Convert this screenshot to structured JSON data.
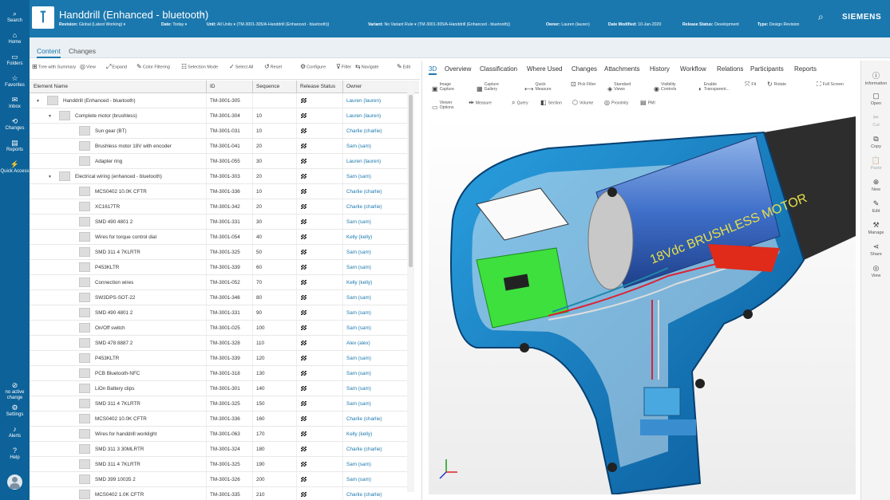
{
  "leftnav": [
    {
      "icon": "search-icon",
      "glyph": "⌕",
      "label": "Search"
    },
    {
      "icon": "home-icon",
      "glyph": "⌂",
      "label": "Home"
    },
    {
      "icon": "folder-icon",
      "glyph": "▭",
      "label": "Folders"
    },
    {
      "icon": "star-icon",
      "glyph": "☆",
      "label": "Favorites"
    },
    {
      "icon": "inbox-icon",
      "glyph": "✉",
      "label": "Inbox"
    },
    {
      "icon": "changes-icon",
      "glyph": "⟲",
      "label": "Changes"
    },
    {
      "icon": "reports-icon",
      "glyph": "▤",
      "label": "Reports"
    },
    {
      "icon": "quick-access-icon",
      "glyph": "⚡",
      "label": "Quick Access"
    }
  ],
  "leftnav_bottom": {
    "no_change": "no active change",
    "settings": "Settings",
    "alerts": "Alerts",
    "help": "Help"
  },
  "header": {
    "title": "Handdrill (Enhanced - bluetooth)",
    "revision_label": "Revision:",
    "revision": "Global (Latest Working)",
    "date_label": "Date:",
    "date": "Today",
    "unit_label": "Unit:",
    "unit": "All Units",
    "unit_id": "(TM-3001-305/A-Handdrill (Enhanced - bluetooth))",
    "variant_label": "Variant:",
    "variant": "No Variant Rule",
    "variant_id": "(TM-3001-305/A-Handdrill (Enhanced - bluetooth))",
    "owner_label": "Owner:",
    "owner": "Lauren (lauren)",
    "modified_label": "Date Modified:",
    "modified": "10-Jan-2020",
    "status_label": "Release Status:",
    "status": "Development",
    "type_label": "Type:",
    "type": "Design Revision",
    "brand": "SIEMENS"
  },
  "maintabs": [
    "Content",
    "Changes"
  ],
  "left_toolbar": [
    {
      "label": "Tree with Summary",
      "icon": "tree-icon",
      "g": "⊞"
    },
    {
      "label": "View",
      "icon": "view-icon",
      "g": "◎"
    },
    {
      "label": "Expand",
      "icon": "expand-icon",
      "g": "⤢"
    },
    {
      "label": "Color Filtering",
      "icon": "color-filter-icon",
      "g": "✎"
    },
    {
      "label": "Selection Mode",
      "icon": "selection-mode-icon",
      "g": "☷"
    },
    {
      "label": "Select All",
      "icon": "check-icon",
      "g": "✓"
    },
    {
      "label": "Reset",
      "icon": "reset-icon",
      "g": "↺"
    },
    {
      "label": "Configure",
      "icon": "configure-icon",
      "g": "⚙"
    },
    {
      "label": "Filter",
      "icon": "filter-icon",
      "g": "⊽"
    },
    {
      "label": "Navigate",
      "icon": "navigate-icon",
      "g": "⇆"
    },
    {
      "label": "Edit",
      "icon": "edit-icon",
      "g": "✎"
    }
  ],
  "table": {
    "headers": [
      "Element Name",
      "ID",
      "Sequence",
      "Release Status",
      "Owner"
    ],
    "rows": [
      {
        "level": 0,
        "tri": "▼",
        "name": "Handdrill (Enhanced - bluetooth)",
        "id": "TM-3001-305",
        "seq": "",
        "owner": "Lauren (lauren)"
      },
      {
        "level": 1,
        "tri": "▼",
        "name": "Complete motor (brushless)",
        "id": "TM-3001-304",
        "seq": "10",
        "owner": "Lauren (lauren)"
      },
      {
        "level": 2,
        "tri": "",
        "name": "Sun gear (BT)",
        "id": "TM-3001-031",
        "seq": "10",
        "owner": "Charlie (charlie)"
      },
      {
        "level": 2,
        "tri": "",
        "name": "Brushless motor 18V with encoder",
        "id": "TM-3001-041",
        "seq": "20",
        "owner": "Sam (sam)"
      },
      {
        "level": 2,
        "tri": "",
        "name": "Adapter ring",
        "id": "TM-3001-055",
        "seq": "30",
        "owner": "Lauren (lauren)"
      },
      {
        "level": 1,
        "tri": "▼",
        "name": "Electrical wiring (enhanced - bluetooth)",
        "id": "TM-3001-303",
        "seq": "20",
        "owner": "Sam (sam)"
      },
      {
        "level": 2,
        "tri": "",
        "name": "MCS0402 10.0K CFTR",
        "id": "TM-3001-336",
        "seq": "10",
        "owner": "Charlie (charlie)"
      },
      {
        "level": 2,
        "tri": "",
        "name": "XC1617TR",
        "id": "TM-3001-342",
        "seq": "20",
        "owner": "Charlie (charlie)"
      },
      {
        "level": 2,
        "tri": "",
        "name": "SMD 490 4801 2",
        "id": "TM-3001-331",
        "seq": "30",
        "owner": "Sam (sam)"
      },
      {
        "level": 2,
        "tri": "",
        "name": "Wires for torque control dial",
        "id": "TM-3001-054",
        "seq": "40",
        "owner": "Kelly (kelly)"
      },
      {
        "level": 2,
        "tri": "",
        "name": "SMD 311 4 7KLRTR",
        "id": "TM-3001-325",
        "seq": "50",
        "owner": "Sam (sam)"
      },
      {
        "level": 2,
        "tri": "",
        "name": "P453KLTR",
        "id": "TM-3001-339",
        "seq": "60",
        "owner": "Sam (sam)"
      },
      {
        "level": 2,
        "tri": "",
        "name": "Connection wires",
        "id": "TM-3001-052",
        "seq": "70",
        "owner": "Kelly (kelly)"
      },
      {
        "level": 2,
        "tri": "",
        "name": "SW3DPS-SOT-22",
        "id": "TM-3001-346",
        "seq": "80",
        "owner": "Sam (sam)"
      },
      {
        "level": 2,
        "tri": "",
        "name": "SMD 490 4801 2",
        "id": "TM-3001-331",
        "seq": "90",
        "owner": "Sam (sam)"
      },
      {
        "level": 2,
        "tri": "",
        "name": "On/Off switch",
        "id": "TM-3001-025",
        "seq": "100",
        "owner": "Sam (sam)"
      },
      {
        "level": 2,
        "tri": "",
        "name": "SMD 478 8887 2",
        "id": "TM-3001-328",
        "seq": "110",
        "owner": "Alex (alex)"
      },
      {
        "level": 2,
        "tri": "",
        "name": "P453KLTR",
        "id": "TM-3001-339",
        "seq": "120",
        "owner": "Sam (sam)"
      },
      {
        "level": 2,
        "tri": "",
        "name": "PCB Bluetooth-NFC",
        "id": "TM-3001-318",
        "seq": "130",
        "owner": "Sam (sam)"
      },
      {
        "level": 2,
        "tri": "",
        "name": "LiOn Battery clips",
        "id": "TM-3001-301",
        "seq": "140",
        "owner": "Sam (sam)"
      },
      {
        "level": 2,
        "tri": "",
        "name": "SMD 311 4 7KLRTR",
        "id": "TM-3001-325",
        "seq": "150",
        "owner": "Sam (sam)"
      },
      {
        "level": 2,
        "tri": "",
        "name": "MCS0402 10.0K CFTR",
        "id": "TM-3001-336",
        "seq": "160",
        "owner": "Charlie (charlie)"
      },
      {
        "level": 2,
        "tri": "",
        "name": "Wires for handdrill worklight",
        "id": "TM-3001-063",
        "seq": "170",
        "owner": "Kelly (kelly)"
      },
      {
        "level": 2,
        "tri": "",
        "name": "SMD 311 3 30MLRTR",
        "id": "TM-3001-324",
        "seq": "180",
        "owner": "Charlie (charlie)"
      },
      {
        "level": 2,
        "tri": "",
        "name": "SMD 311 4 7KLRTR",
        "id": "TM-3001-325",
        "seq": "190",
        "owner": "Sam (sam)"
      },
      {
        "level": 2,
        "tri": "",
        "name": "SMD 399 10035 2",
        "id": "TM-3001-326",
        "seq": "200",
        "owner": "Sam (sam)"
      },
      {
        "level": 2,
        "tri": "",
        "name": "MCS0402 1.0K CFTR",
        "id": "TM-3001-335",
        "seq": "210",
        "owner": "Charlie (charlie)"
      }
    ]
  },
  "rtabs": [
    "3D",
    "Overview",
    "Classification",
    "Where Used",
    "Changes",
    "Attachments",
    "History",
    "Workflow",
    "Relations",
    "Participants",
    "Reports"
  ],
  "viewer_tools_row1": [
    {
      "label": "Image Capture",
      "icon": "image-capture-icon",
      "g": "▣"
    },
    {
      "label": "Capture Gallery",
      "icon": "capture-gallery-icon",
      "g": "▦"
    },
    {
      "label": "Quick Measure",
      "icon": "quick-measure-icon",
      "g": "⟷"
    },
    {
      "label": "Pick Filter",
      "icon": "pick-filter-icon",
      "g": "⊡"
    },
    {
      "label": "Standard Views",
      "icon": "standard-views-icon",
      "g": "◈"
    },
    {
      "label": "Visibility Controls",
      "icon": "visibility-icon",
      "g": "◉"
    },
    {
      "label": "Enable Transparent...",
      "icon": "transparent-icon",
      "g": "◐"
    },
    {
      "label": "Fit",
      "icon": "fit-icon",
      "g": "⤧"
    },
    {
      "label": "Rotate",
      "icon": "rotate-icon",
      "g": "↻"
    },
    {
      "label": "Full Screen",
      "icon": "full-screen-icon",
      "g": "⛶"
    }
  ],
  "viewer_tools_row2": [
    {
      "label": "Viewer Options",
      "icon": "viewer-options-icon",
      "g": "▭"
    },
    {
      "label": "Measure",
      "icon": "measure-icon",
      "g": "⇹"
    },
    {
      "label": "Query",
      "icon": "query-icon",
      "g": "⌕"
    },
    {
      "label": "Section",
      "icon": "section-icon",
      "g": "◧"
    },
    {
      "label": "Volume",
      "icon": "volume-icon",
      "g": "⬡"
    },
    {
      "label": "Proximity",
      "icon": "proximity-icon",
      "g": "◎"
    },
    {
      "label": "PMI",
      "icon": "pmi-icon",
      "g": "▤"
    }
  ],
  "model_text": {
    "motor": "18Vdc BRUSHLESS MOTOR"
  },
  "right_rail": [
    {
      "label": "Information",
      "icon": "info-icon",
      "g": "ⓘ",
      "dis": false
    },
    {
      "label": "Open",
      "icon": "open-icon",
      "g": "▢",
      "dis": false
    },
    {
      "label": "Cut",
      "icon": "cut-icon",
      "g": "✂",
      "dis": true
    },
    {
      "label": "Copy",
      "icon": "copy-icon",
      "g": "⧉",
      "dis": false
    },
    {
      "label": "Paste",
      "icon": "paste-icon",
      "g": "📋",
      "dis": true
    },
    {
      "label": "New",
      "icon": "new-icon",
      "g": "⊕",
      "dis": false
    },
    {
      "label": "Edit",
      "icon": "edit-icon",
      "g": "✎",
      "dis": false
    },
    {
      "label": "Manage",
      "icon": "manage-icon",
      "g": "⚒",
      "dis": false
    },
    {
      "label": "Share",
      "icon": "share-icon",
      "g": "⋖",
      "dis": false
    },
    {
      "label": "View",
      "icon": "view-icon",
      "g": "◎",
      "dis": false
    }
  ]
}
